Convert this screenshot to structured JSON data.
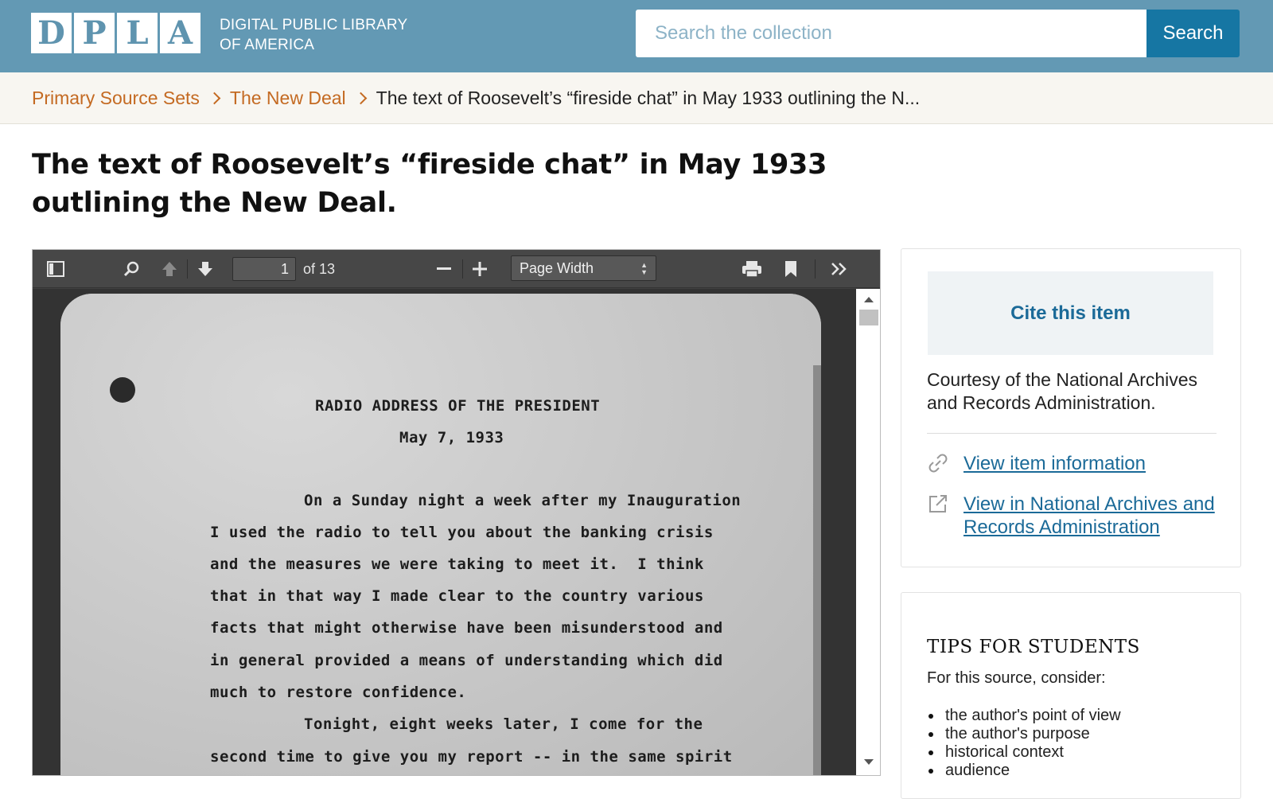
{
  "header": {
    "logo_letters": [
      "D",
      "P",
      "L",
      "A"
    ],
    "logo_text_line1": "DIGITAL PUBLIC LIBRARY",
    "logo_text_line2": "OF AMERICA",
    "search_placeholder": "Search the collection",
    "search_button_label": "Search",
    "bg_color": "#6399b4",
    "button_color": "#1676a3"
  },
  "breadcrumb": {
    "items": [
      "Primary Source Sets",
      "The New Deal"
    ],
    "current": "The text of Roosevelt’s “fireside chat” in May 1933 outlining the N..."
  },
  "page_title": "The text of Roosevelt’s “fireside chat” in May 1933 outlining the New Deal.",
  "viewer": {
    "page_number": "1",
    "page_count": "of 13",
    "zoom": "Page Width",
    "icons": [
      "sidebar-toggle-icon",
      "search-icon",
      "previous-page-icon",
      "next-page-icon",
      "zoom-out-icon",
      "zoom-in-icon",
      "print-icon",
      "bookmark-icon",
      "tools-icon"
    ],
    "document": {
      "heading": "RADIO ADDRESS OF THE PRESIDENT",
      "date": "May 7, 1933",
      "lines": [
        "On a Sunday night a week after my Inauguration",
        "I used the radio to tell you about the banking crisis",
        "and the measures we were taking to meet it.  I think",
        "that in that way I made clear to the country various",
        "facts that might otherwise have been misunderstood and",
        "in general provided a means of understanding which did",
        "much to restore confidence.",
        "Tonight, eight weeks later, I come for the",
        "second time to give you my report -- in the same spirit"
      ]
    }
  },
  "sidebar": {
    "cite_label": "Cite this item",
    "courtesy": "Courtesy of the National Archives and Records Administration.",
    "links": [
      {
        "icon": "link-icon",
        "label": "View item information"
      },
      {
        "icon": "external-link-icon",
        "label": "View in National Archives and Records Administration"
      }
    ],
    "tips": {
      "title": "TIPS FOR STUDENTS",
      "intro": "For this source, consider:",
      "items": [
        "the author's point of view",
        "the author's purpose",
        "historical context",
        "audience"
      ]
    }
  }
}
